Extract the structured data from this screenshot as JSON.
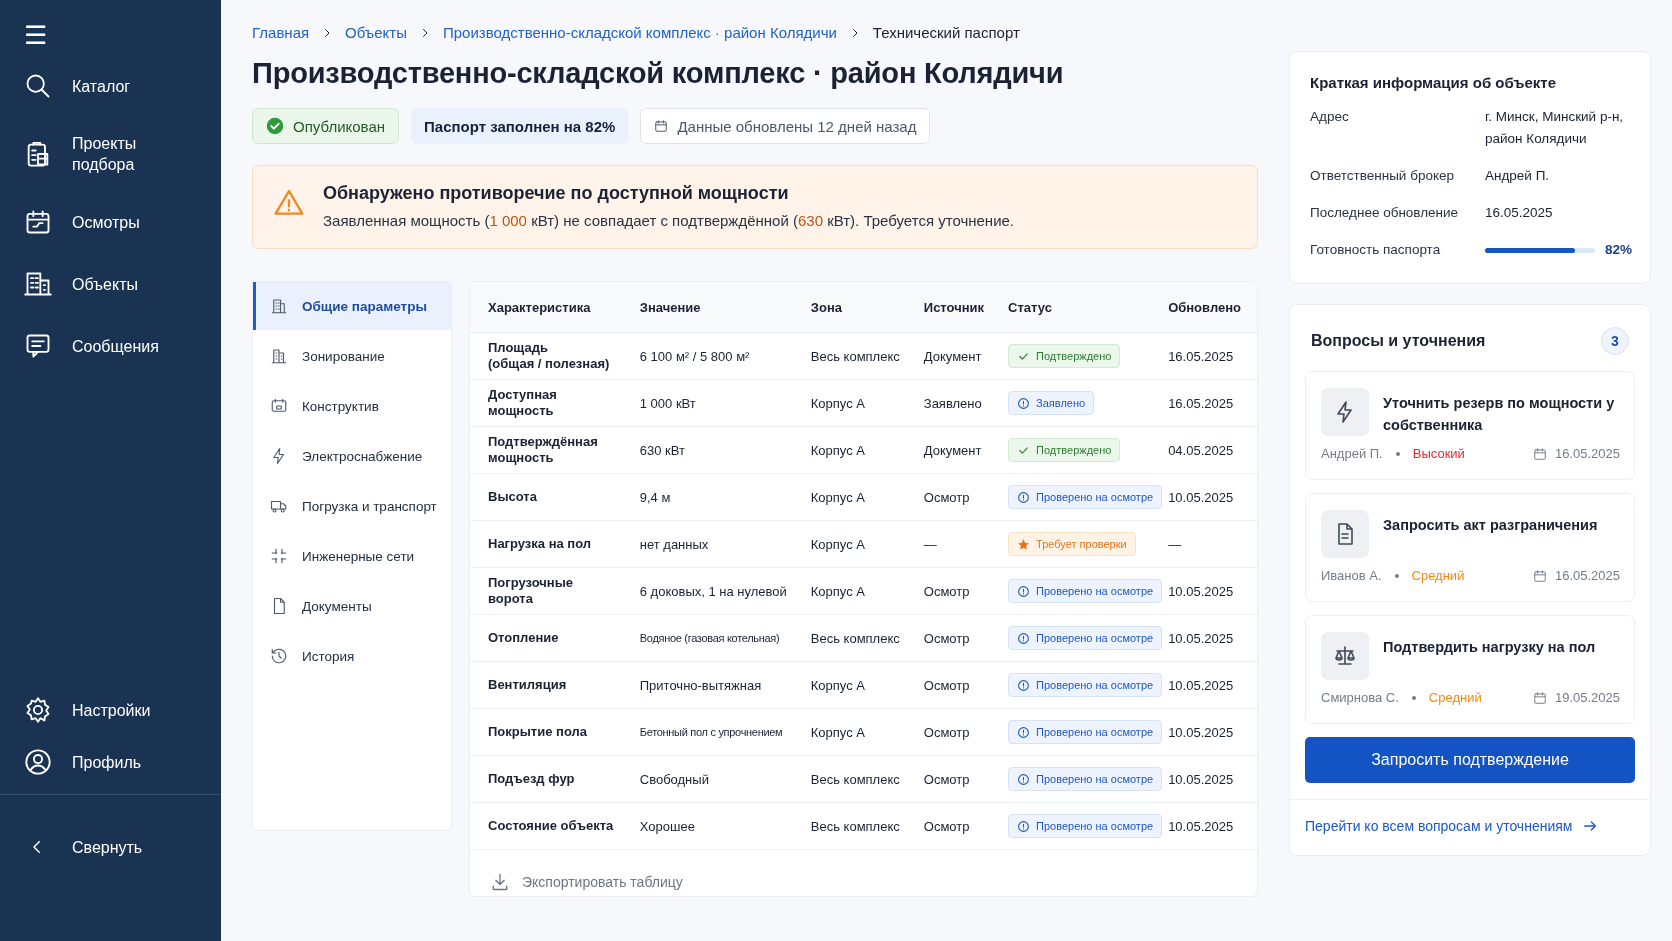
{
  "sidebar": {
    "menu_label": "☰",
    "items": [
      {
        "label": "Каталог"
      },
      {
        "label": "Проекты подбора"
      },
      {
        "label": "Осмотры"
      },
      {
        "label": "Объекты"
      },
      {
        "label": "Сообщения"
      }
    ],
    "bottom_items": [
      {
        "label": "Настройки"
      },
      {
        "label": "Профиль"
      }
    ],
    "collapse": {
      "label": "Свернуть"
    }
  },
  "breadcrumbs": [
    {
      "label": "Главная",
      "current": false
    },
    {
      "label": "Объекты",
      "current": false
    },
    {
      "label": "Производственно-складской комплекс · район Колядичи",
      "current": false
    },
    {
      "label": "Технический паспорт",
      "current": true
    }
  ],
  "title": "Производственно-складской комплекс · район Колядичи",
  "badges": [
    {
      "kind": "published",
      "label": "Опубликован"
    },
    {
      "kind": "progress",
      "label": "Паспорт заполнен на 82%"
    },
    {
      "kind": "updated",
      "label": "Данные обновлены 12 дней назад"
    }
  ],
  "alert": {
    "title": "Обнаружено противоречие по доступной мощности",
    "parts": [
      {
        "text": "Заявленная мощность (",
        "highlight": false
      },
      {
        "text": "1 000",
        "highlight": true
      },
      {
        "text": " кВт) не совпадает с подтверждённой (",
        "highlight": false
      },
      {
        "text": "630",
        "highlight": true
      },
      {
        "text": " кВт). Требуется уточнение.",
        "highlight": false
      }
    ]
  },
  "sections": [
    {
      "label": "Общие параметры",
      "selected": true
    },
    {
      "label": "Зонирование",
      "selected": false
    },
    {
      "label": "Конструктив",
      "selected": false
    },
    {
      "label": "Электроснабжение",
      "selected": false
    },
    {
      "label": "Погрузка и транспорт",
      "selected": false
    },
    {
      "label": "Инженерные сети",
      "selected": false
    },
    {
      "label": "Документы",
      "selected": false
    },
    {
      "label": "История",
      "selected": false
    }
  ],
  "table": {
    "columns": [
      "Характеристика",
      "Значение",
      "Зона",
      "Источник",
      "Статус",
      "Обновлено"
    ],
    "rows": [
      {
        "name": "Площадь\n(общая / полезная)",
        "value": "6 100 м² / 5 800 м²",
        "compact": false,
        "zone": "Весь комплекс",
        "source": "Документ",
        "status": {
          "kind": "confirmed",
          "label": "Подтверждено"
        },
        "updated": "16.05.2025"
      },
      {
        "name": "Доступная мощность",
        "value": "1 000 кВт",
        "compact": false,
        "zone": "Корпус А",
        "source": "Заявлено",
        "status": {
          "kind": "declared",
          "label": "Заявлено"
        },
        "updated": "16.05.2025"
      },
      {
        "name": "Подтверждённая\nмощность",
        "value": "630 кВт",
        "compact": false,
        "zone": "Корпус А",
        "source": "Документ",
        "status": {
          "kind": "confirmed",
          "label": "Подтверждено"
        },
        "updated": "04.05.2025"
      },
      {
        "name": "Высота",
        "value": "9,4 м",
        "compact": false,
        "zone": "Корпус А",
        "source": "Осмотр",
        "status": {
          "kind": "inspected",
          "label": "Проверено на осмотре"
        },
        "updated": "10.05.2025"
      },
      {
        "name": "Нагрузка на пол",
        "value": "нет данных",
        "compact": false,
        "zone": "Корпус А",
        "source": "—",
        "status": {
          "kind": "needs_check",
          "label": "Требует проверки"
        },
        "updated": "—"
      },
      {
        "name": "Погрузочные ворота",
        "value": "6 доковых, 1 на нулевой",
        "compact": false,
        "zone": "Корпус А",
        "source": "Осмотр",
        "status": {
          "kind": "inspected",
          "label": "Проверено на осмотре"
        },
        "updated": "10.05.2025"
      },
      {
        "name": "Отопление",
        "value": "Водяное (газовая котельная)",
        "compact": true,
        "zone": "Весь комплекс",
        "source": "Осмотр",
        "status": {
          "kind": "inspected",
          "label": "Проверено на осмотре"
        },
        "updated": "10.05.2025"
      },
      {
        "name": "Вентиляция",
        "value": "Приточно-вытяжная",
        "compact": false,
        "zone": "Корпус А",
        "source": "Осмотр",
        "status": {
          "kind": "inspected",
          "label": "Проверено на осмотре"
        },
        "updated": "10.05.2025"
      },
      {
        "name": "Покрытие пола",
        "value": "Бетонный пол с упрочнением",
        "compact": true,
        "zone": "Корпус А",
        "source": "Осмотр",
        "status": {
          "kind": "inspected",
          "label": "Проверено на осмотре"
        },
        "updated": "10.05.2025"
      },
      {
        "name": "Подъезд фур",
        "value": "Свободный",
        "compact": false,
        "zone": "Весь комплекс",
        "source": "Осмотр",
        "status": {
          "kind": "inspected",
          "label": "Проверено на осмотре"
        },
        "updated": "10.05.2025"
      },
      {
        "name": "Состояние объекта",
        "value": "Хорошее",
        "compact": false,
        "zone": "Весь комплекс",
        "source": "Осмотр",
        "status": {
          "kind": "inspected",
          "label": "Проверено на осмотре"
        },
        "updated": "10.05.2025"
      }
    ],
    "export": "Экспортировать таблицу"
  },
  "summary": {
    "title": "Краткая информация об объекте",
    "fields": [
      {
        "label": "Адрес",
        "value": "г. Минск, Минский р-н, район Колядичи"
      },
      {
        "label": "Ответственный брокер",
        "value": "Андрей П."
      },
      {
        "label": "Последнее обновление",
        "value": "16.05.2025"
      }
    ],
    "readiness": {
      "label": "Готовность паспорта",
      "level": 0.82,
      "reading": "82%"
    }
  },
  "questions": {
    "title": "Вопросы и уточнения",
    "count": "3",
    "items": [
      {
        "title": "Уточнить резерв по мощности у собственника",
        "author": "Андрей П.",
        "priority": {
          "kind": "high",
          "label": "Высокий"
        },
        "date": "16.05.2025"
      },
      {
        "title": "Запросить акт разграничения",
        "author": "Иванов А.",
        "priority": {
          "kind": "medium",
          "label": "Средний"
        },
        "date": "16.05.2025"
      },
      {
        "title": "Подтвердить нагрузку на пол",
        "author": "Смирнова С.",
        "priority": {
          "kind": "medium",
          "label": "Средний"
        },
        "date": "19.05.2025"
      }
    ],
    "button": "Запросить подтверждение",
    "link": "Перейти ко всем вопросам и уточнениям"
  }
}
